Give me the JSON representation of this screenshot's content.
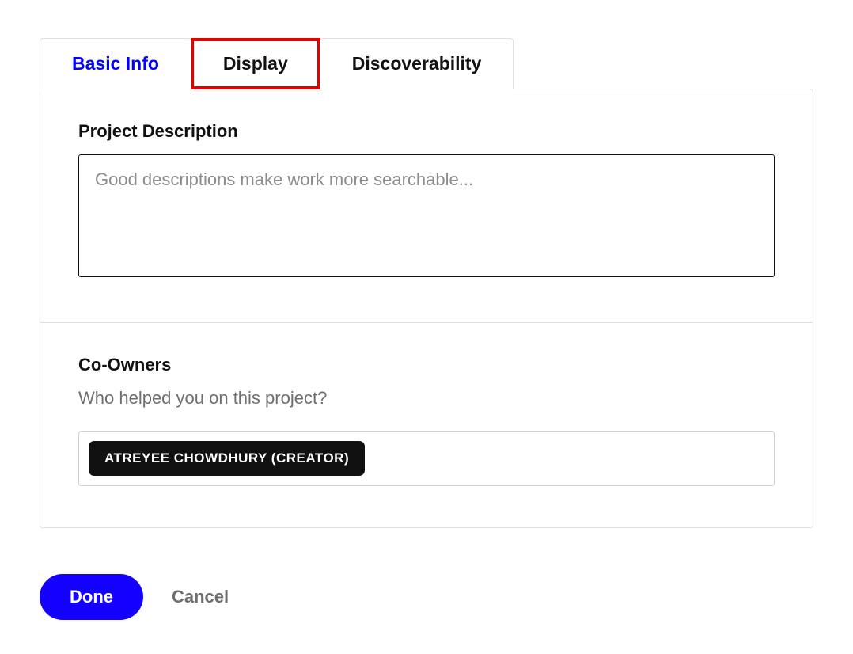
{
  "tabs": {
    "basic_info": "Basic Info",
    "display": "Display",
    "discoverability": "Discoverability"
  },
  "description": {
    "label": "Project Description",
    "placeholder": "Good descriptions make work more searchable...",
    "value": ""
  },
  "coowners": {
    "label": "Co-Owners",
    "sublabel": "Who helped you on this project?",
    "chips": [
      "ATREYEE CHOWDHURY (CREATOR)"
    ]
  },
  "buttons": {
    "done": "Done",
    "cancel": "Cancel"
  }
}
